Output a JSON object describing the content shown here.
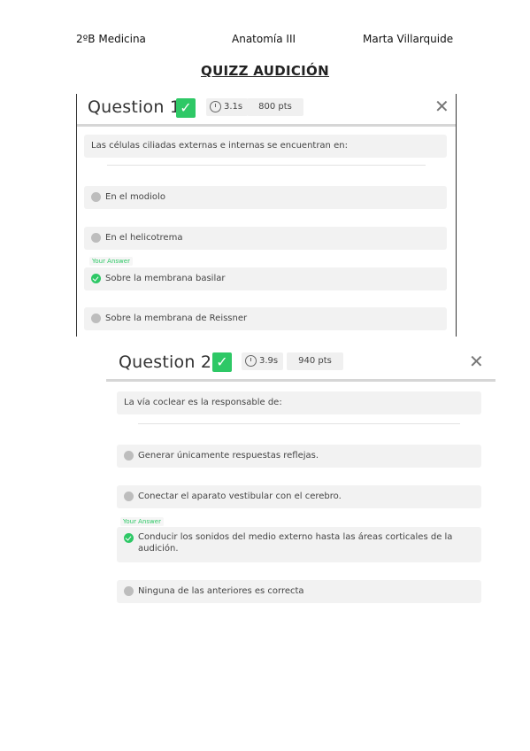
{
  "header": {
    "course": "2ºB Medicina",
    "subject": "Anatomía III",
    "author": "Marta Villarquide"
  },
  "title": "QUIZZ AUDICIÓN",
  "colors": {
    "correct": "#2ec866",
    "neutral": "#bdbdbd",
    "panel": "#f2f2f2"
  },
  "questions": [
    {
      "title": "Question 1",
      "time": "3.1s",
      "points": "800 pts",
      "text": "Las células ciliadas externas e internas se encuentran en:",
      "your_answer_label": "Your Answer",
      "options": [
        "En el modiolo",
        "En el helicotrema",
        "Sobre la membrana basilar",
        "Sobre la membrana de Reissner"
      ]
    },
    {
      "title": "Question 2",
      "time": "3.9s",
      "points": "940 pts",
      "text": "La vía coclear es la responsable de:",
      "your_answer_label": "Your Answer",
      "options": [
        "Generar únicamente respuestas reflejas.",
        "Conectar el aparato vestibular con el cerebro.",
        "Conducir los sonidos del medio externo hasta las áreas corticales de la audición.",
        "Ninguna de las anteriores es correcta"
      ]
    }
  ]
}
